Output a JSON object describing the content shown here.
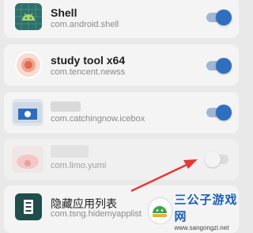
{
  "apps": [
    {
      "title": "Shell",
      "package": "com.android.shell",
      "enabled": true
    },
    {
      "title": "study tool x64",
      "package": "com.tencent.newss",
      "enabled": true
    },
    {
      "title": "",
      "package": "com.catchingnow.icebox",
      "enabled": true
    },
    {
      "title": "",
      "package": "com.limo.yumi",
      "enabled": false
    },
    {
      "title": "隐藏应用列表",
      "package": "com.tsng.hidemyapplist",
      "enabled": true
    }
  ],
  "watermark": {
    "title": "三公子游戏网",
    "url": "www.sangongzi.net"
  },
  "colors": {
    "toggle_on": "#2f6fbf",
    "toggle_track_on": "#9fb6d6",
    "arrow": "#e53935",
    "watermark_blue": "#1c5fb8"
  }
}
